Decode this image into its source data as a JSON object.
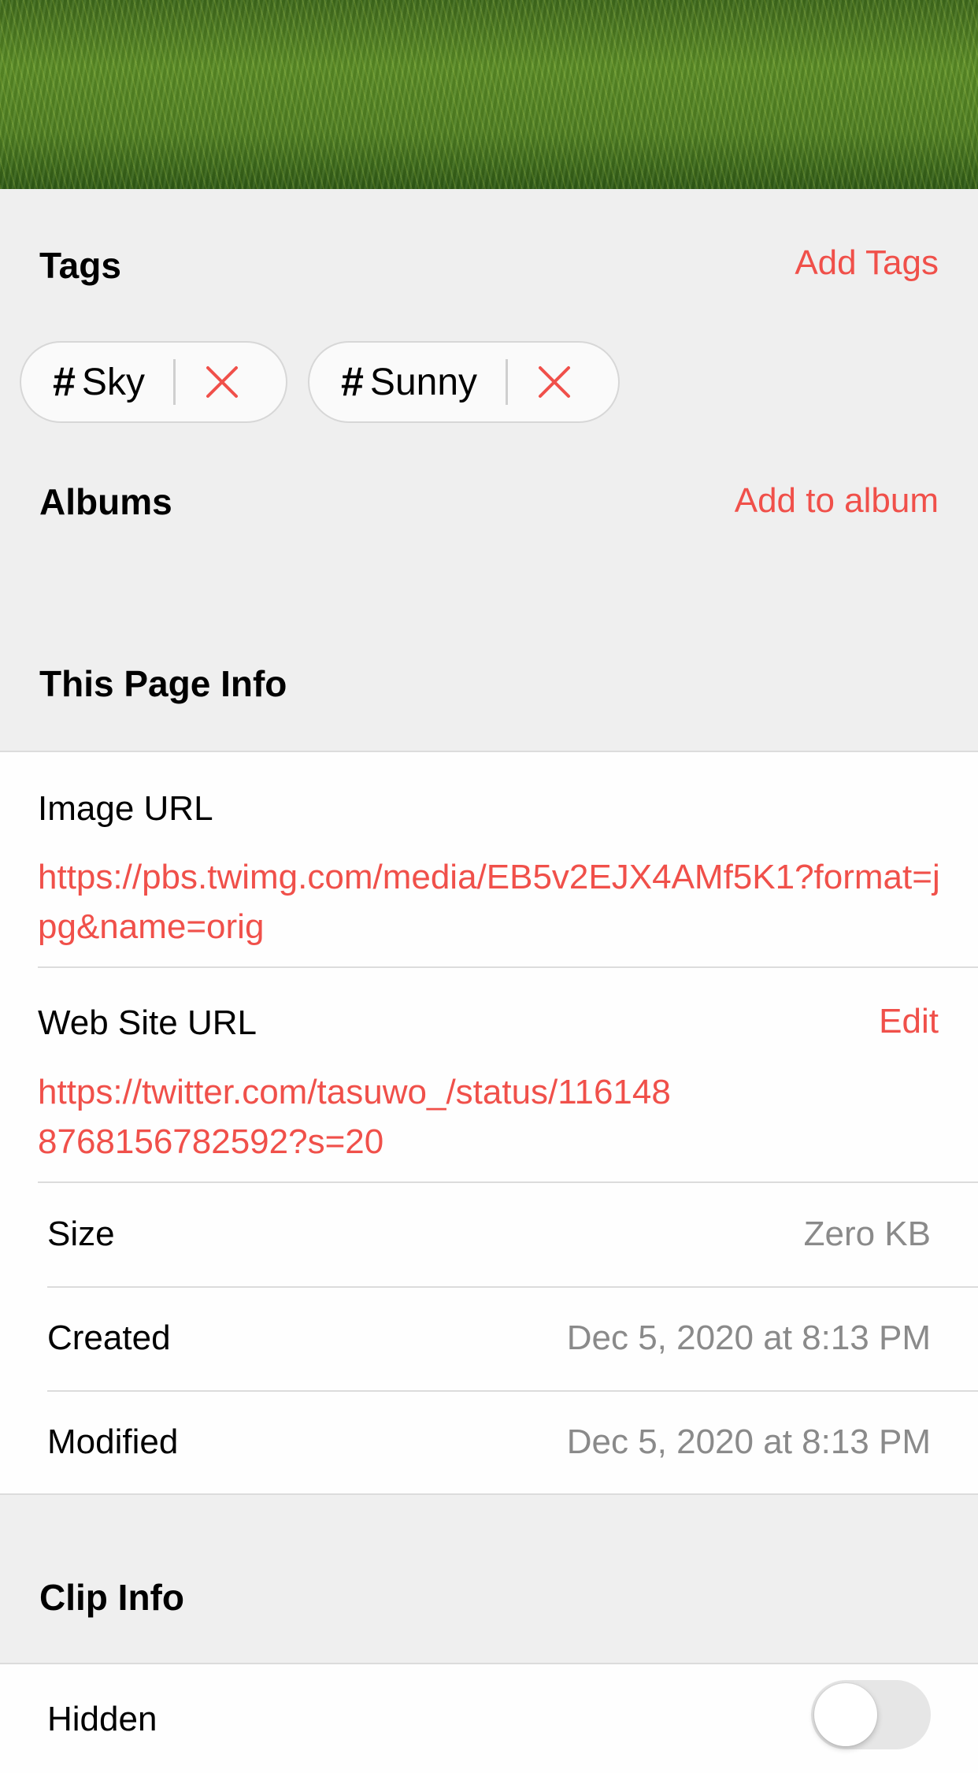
{
  "colors": {
    "accent": "#f0504a",
    "secondary_text": "#8a8a8a",
    "grouped_background": "#efefef"
  },
  "tags_section": {
    "title": "Tags",
    "action": "Add Tags",
    "tags": [
      {
        "hash": "#",
        "label": "Sky",
        "remove_icon": "close-icon"
      },
      {
        "hash": "#",
        "label": "Sunny",
        "remove_icon": "close-icon"
      }
    ]
  },
  "albums_section": {
    "title": "Albums",
    "action": "Add to album"
  },
  "page_info": {
    "title": "This Page Info",
    "image_url": {
      "label": "Image URL",
      "value": "https://pbs.twimg.com/media/EB5v2EJX4AMf5K1?format=jpg&name=orig"
    },
    "website_url": {
      "label": "Web Site URL",
      "edit": "Edit",
      "value": "https://twitter.com/tasuwo_/status/1161488768156782592?s=20"
    },
    "rows": [
      {
        "label": "Size",
        "value": "Zero KB"
      },
      {
        "label": "Created",
        "value": "Dec 5, 2020 at 8:13 PM"
      },
      {
        "label": "Modified",
        "value": "Dec 5, 2020 at 8:13 PM"
      }
    ]
  },
  "clip_info": {
    "title": "Clip Info",
    "hidden": {
      "label": "Hidden",
      "on": false
    }
  }
}
